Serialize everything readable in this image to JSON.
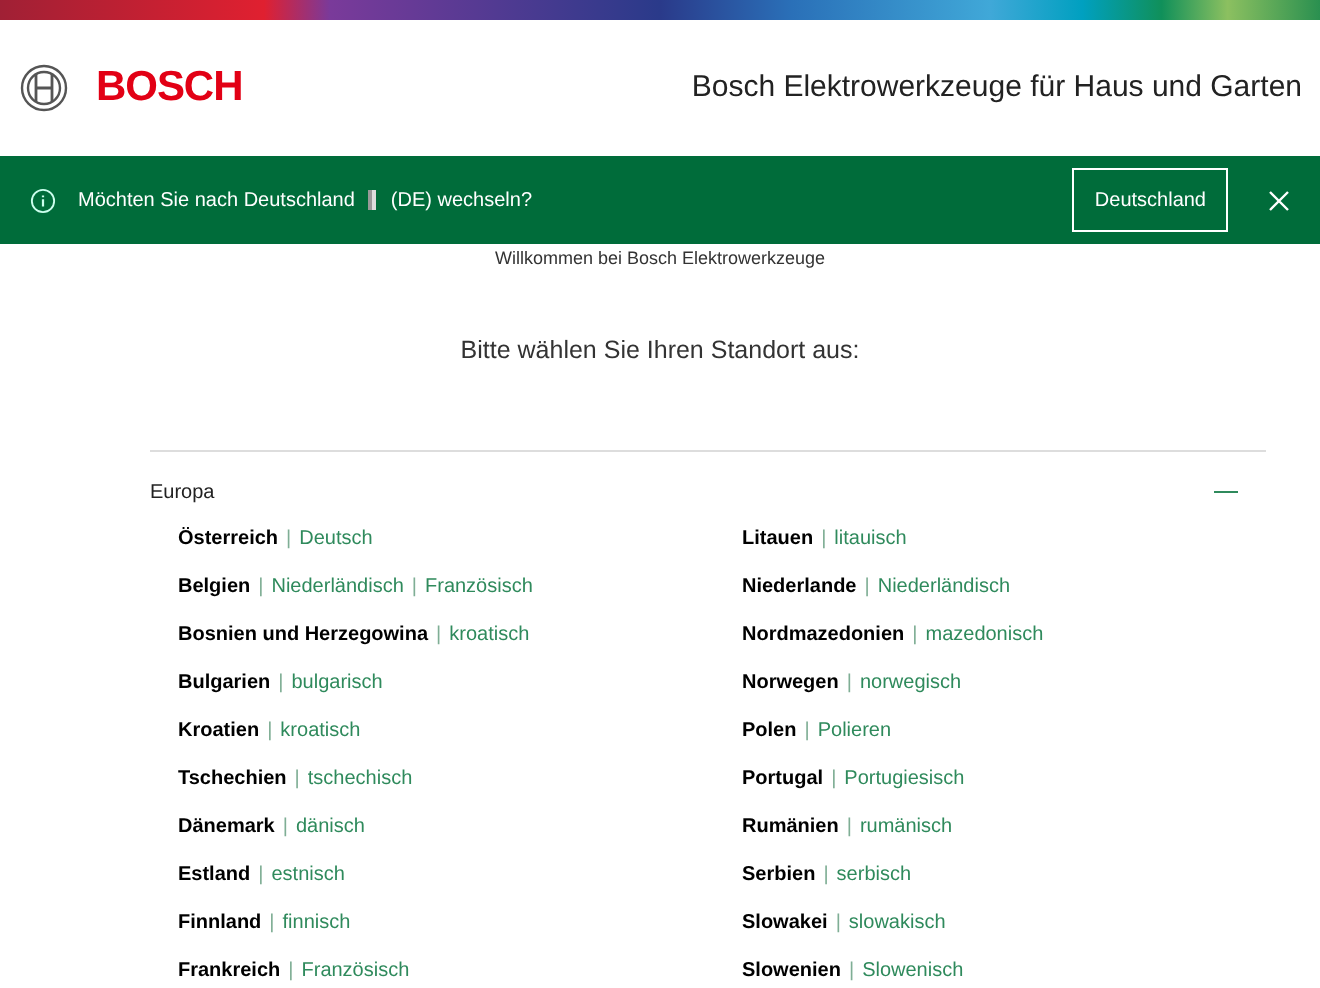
{
  "header": {
    "logo_text": "BOSCH",
    "title": "Bosch Elektrowerkzeuge für Haus und Garten"
  },
  "banner": {
    "message_before": "Möchten Sie nach Deutschland",
    "message_after": "(DE) wechseln?",
    "button": "Deutschland"
  },
  "welcome": "Willkommen bei Bosch Elektrowerkzeuge",
  "prompt": "Bitte wählen Sie Ihren Standort aus:",
  "language_separator": "|",
  "region": {
    "name": "Europa",
    "expanded": true,
    "countries": [
      {
        "name": "Österreich",
        "languages": [
          "Deutsch"
        ]
      },
      {
        "name": "Belgien",
        "languages": [
          "Niederländisch",
          "Französisch"
        ]
      },
      {
        "name": "Bosnien und Herzegowina",
        "languages": [
          "kroatisch"
        ]
      },
      {
        "name": "Bulgarien",
        "languages": [
          "bulgarisch"
        ]
      },
      {
        "name": "Kroatien",
        "languages": [
          "kroatisch"
        ]
      },
      {
        "name": "Tschechien",
        "languages": [
          "tschechisch"
        ]
      },
      {
        "name": "Dänemark",
        "languages": [
          "dänisch"
        ]
      },
      {
        "name": "Estland",
        "languages": [
          "estnisch"
        ]
      },
      {
        "name": "Finnland",
        "languages": [
          "finnisch"
        ]
      },
      {
        "name": "Frankreich",
        "languages": [
          "Französisch"
        ]
      },
      {
        "name": "Litauen",
        "languages": [
          "litauisch"
        ]
      },
      {
        "name": "Niederlande",
        "languages": [
          "Niederländisch"
        ]
      },
      {
        "name": "Nordmazedonien",
        "languages": [
          "mazedonisch"
        ]
      },
      {
        "name": "Norwegen",
        "languages": [
          "norwegisch"
        ]
      },
      {
        "name": "Polen",
        "languages": [
          "Polieren"
        ]
      },
      {
        "name": "Portugal",
        "languages": [
          "Portugiesisch"
        ]
      },
      {
        "name": "Rumänien",
        "languages": [
          "rumänisch"
        ]
      },
      {
        "name": "Serbien",
        "languages": [
          "serbisch"
        ]
      },
      {
        "name": "Slowakei",
        "languages": [
          "slowakisch"
        ]
      },
      {
        "name": "Slowenien",
        "languages": [
          "Slowenisch"
        ]
      }
    ]
  }
}
